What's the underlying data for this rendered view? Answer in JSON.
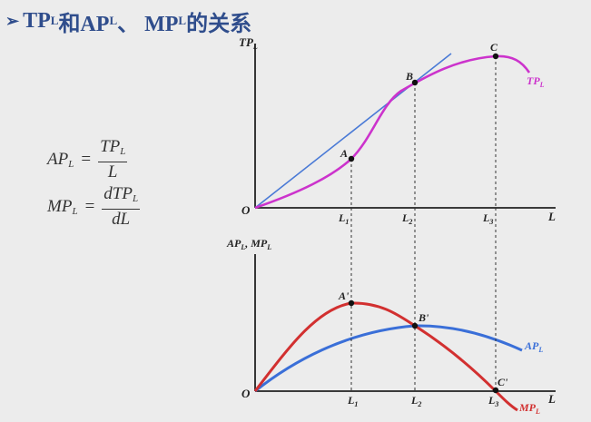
{
  "title": {
    "arrow": "➢",
    "text": [
      "TP",
      "L",
      "和AP",
      "L",
      "、 MP",
      "L",
      "的关系"
    ]
  },
  "formulas": {
    "ap": {
      "lhs": "AP",
      "lhs_sub": "L",
      "eq": "=",
      "num": "TP",
      "num_sub": "L",
      "den": "L"
    },
    "mp": {
      "lhs": "MP",
      "lhs_sub": "L",
      "eq": "=",
      "num": "dTP",
      "num_sub": "L",
      "den": "dL"
    }
  },
  "top_graph": {
    "y_axis_label": "TP",
    "y_axis_sub": "L",
    "x_axis_label": "L",
    "origin_label": "O",
    "curve_label": "TP",
    "curve_sub": "L",
    "points": [
      "A",
      "B",
      "C"
    ],
    "ticks": [
      {
        "label": "L",
        "sub": "1"
      },
      {
        "label": "L",
        "sub": "2"
      },
      {
        "label": "L",
        "sub": "3"
      }
    ]
  },
  "bottom_graph": {
    "y_axis_label": "AP",
    "y_axis_sub": "L",
    "y_axis_sep": ", ",
    "y_axis_label2": "MP",
    "y_axis_sub2": "L",
    "x_axis_label": "L",
    "origin_label": "O",
    "ap_label": "AP",
    "ap_sub": "L",
    "mp_label": "MP",
    "mp_sub": "L",
    "points": [
      "A'",
      "B'",
      "C'"
    ],
    "ticks": [
      {
        "label": "L",
        "sub": "1"
      },
      {
        "label": "L",
        "sub": "2"
      },
      {
        "label": "L",
        "sub": "3"
      }
    ]
  },
  "colors": {
    "title": "#2f4d8c",
    "tp_curve": "#cc33cc",
    "tangent": "#4a7ad6",
    "ap_curve": "#3a6fd8",
    "mp_curve": "#d23030",
    "mp_label": "#d23030",
    "axis": "#222222"
  }
}
